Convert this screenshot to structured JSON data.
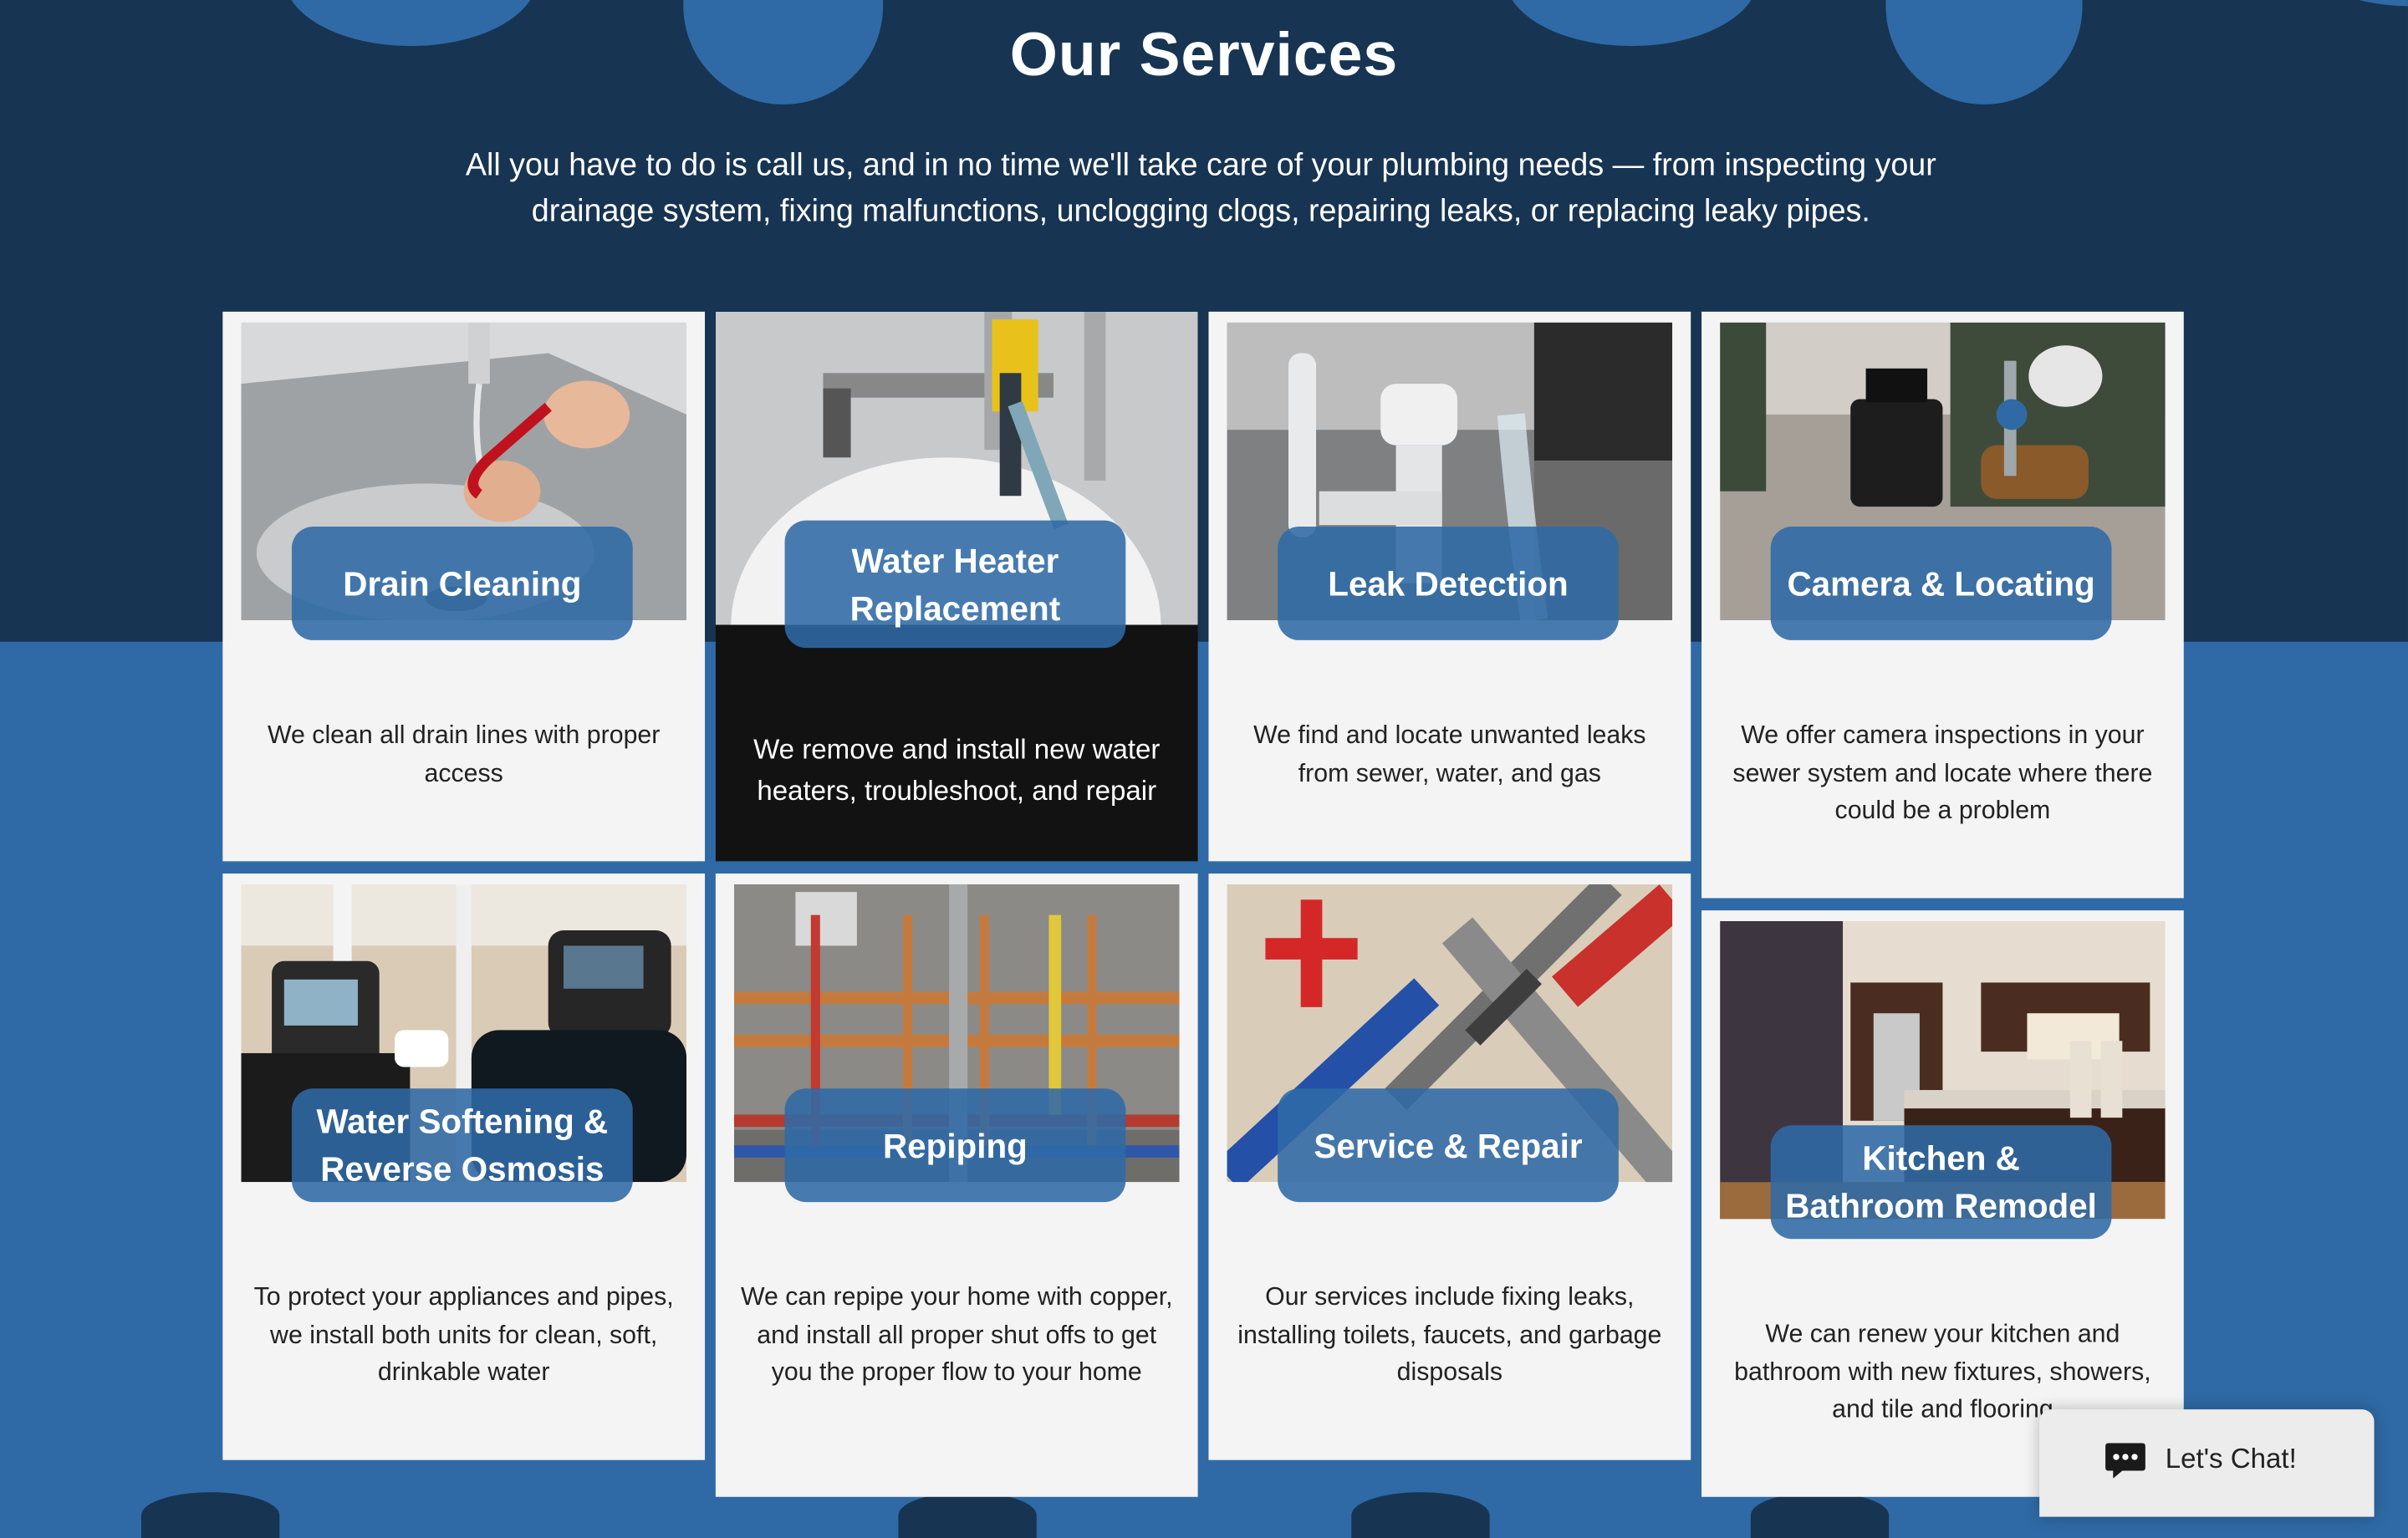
{
  "section": {
    "title": "Our Services",
    "intro": "All you have to do is call us, and in no time we'll take care of your plumbing needs — from inspecting your drainage system, fixing malfunctions, unclogging clogs, repairing leaks, or replacing leaky pipes."
  },
  "services": [
    {
      "title": "Drain Cleaning",
      "description": "We clean all drain lines with proper access"
    },
    {
      "title": "Water Heater Replacement",
      "description": "We remove and install new water heaters, troubleshoot, and repair"
    },
    {
      "title": "Leak Detection",
      "description": "We find and locate unwanted leaks from sewer, water, and gas"
    },
    {
      "title": "Camera & Locating",
      "description": "We offer camera inspections in your sewer system and locate where there could be a problem"
    },
    {
      "title": "Water Softening & Reverse Osmosis",
      "description": "To protect your appliances and pipes, we install both units for clean, soft, drinkable water"
    },
    {
      "title": "Repiping",
      "description": "We can repipe your home with copper, and install all proper shut offs to get you the proper flow to your home"
    },
    {
      "title": "Service & Repair",
      "description": "Our services include fixing leaks, installing toilets, faucets, and garbage disposals"
    },
    {
      "title": "Kitchen & Bathroom Remodel",
      "description": "We can renew your kitchen and bathroom with new fixtures, showers, and tile and flooring"
    }
  ],
  "chat": {
    "label": "Let's Chat!",
    "icon": "chat-bubble-icon"
  },
  "colors": {
    "navy": "#173452",
    "blue": "#2f6aa6",
    "card": "#f4f4f4",
    "dark_card": "#121212"
  }
}
